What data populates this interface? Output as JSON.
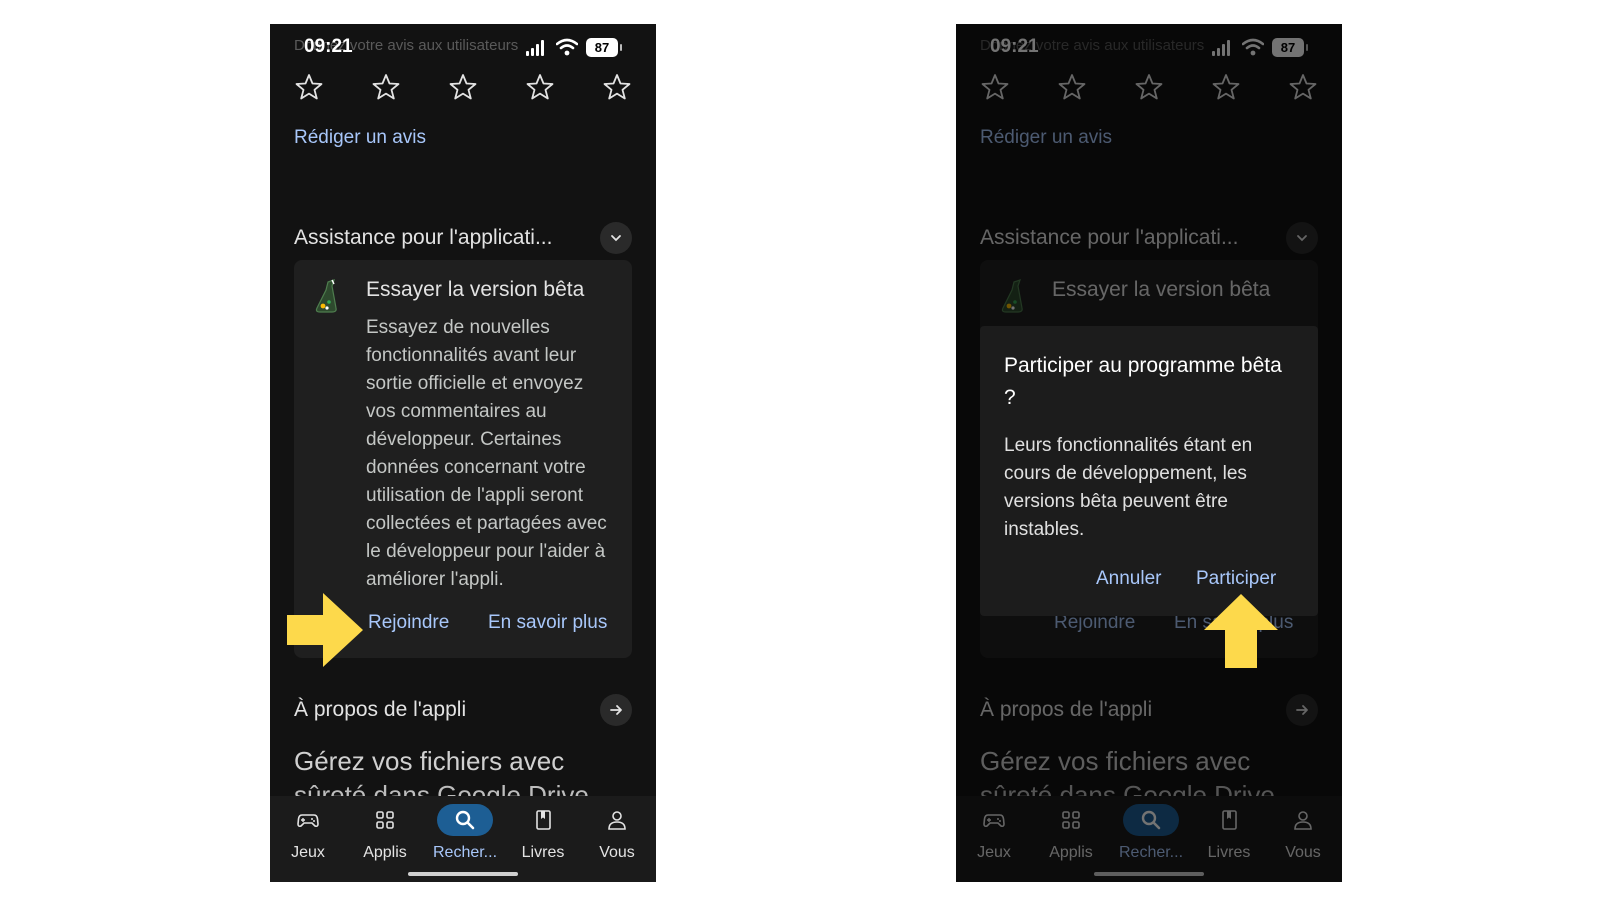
{
  "status_bar": {
    "time": "09:21",
    "battery": "87",
    "ghost_text": "Donnez votre avis aux utilisateurs"
  },
  "rating": {
    "stars_total": 5
  },
  "write_review": "Rédiger un avis",
  "support_section": {
    "title": "Assistance pour l'applicati..."
  },
  "beta_card": {
    "title": "Essayer la version bêta",
    "description": "Essayez de nouvelles fonctionnalités avant leur sortie officielle et envoyez vos commentaires au développeur. Certaines données concernant votre utilisation de l'appli seront collectées et partagées avec le développeur pour l'aider à améliorer l'appli.",
    "join_label": "Rejoindre",
    "learn_more_label": "En savoir plus"
  },
  "about_section": {
    "title": "À propos de l'appli",
    "description": "Gérez vos fichiers avec",
    "description_cut": "sûreté dans Google Drive"
  },
  "dialog": {
    "title": "Participer au programme bêta ?",
    "body": "Leurs fonctionnalités étant en cours de développement, les versions bêta peuvent être instables.",
    "cancel_label": "Annuler",
    "participate_label": "Participer"
  },
  "bottom_nav": {
    "items": [
      {
        "label": "Jeux",
        "icon": "gamepad-icon"
      },
      {
        "label": "Applis",
        "icon": "apps-grid-icon"
      },
      {
        "label": "Recher...",
        "icon": "search-icon",
        "active": true
      },
      {
        "label": "Livres",
        "icon": "book-icon"
      },
      {
        "label": "Vous",
        "icon": "person-icon"
      }
    ]
  },
  "colors": {
    "background": "#121212",
    "link": "#a8c7fa",
    "active_nav": "#1d5e94",
    "arrow": "#fdd94b"
  }
}
